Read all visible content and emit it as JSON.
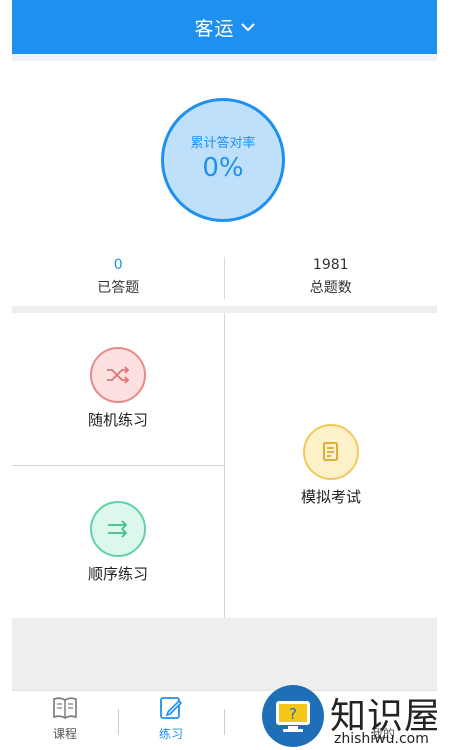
{
  "header": {
    "title": "客运"
  },
  "stats": {
    "ring_label": "累计答对率",
    "ring_value": "0%",
    "answered_count": "0",
    "answered_label": "已答题",
    "total_count": "1981",
    "total_label": "总题数"
  },
  "tiles": {
    "random": "随机练习",
    "order": "顺序练习",
    "mock": "模拟考试"
  },
  "nav": {
    "items": [
      {
        "label": "课程"
      },
      {
        "label": "练习"
      },
      {
        "label": ""
      },
      {
        "label": "我的"
      }
    ],
    "active_index": 1
  },
  "watermark": {
    "text": "知识屋",
    "sub": "zhishiwu.com",
    "reg": "®"
  },
  "colors": {
    "accent": "#1e90f0",
    "random": "#e88a8a",
    "order": "#5fd3a5",
    "mock": "#f0c95a"
  }
}
